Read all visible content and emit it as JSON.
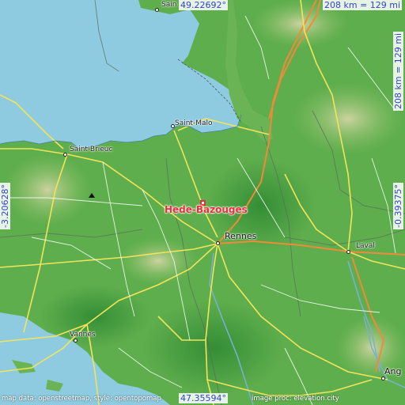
{
  "place": {
    "name": "Hede-Bazouges"
  },
  "cities": {
    "saint_malo": "Saint-Malo",
    "saint_brieuc": "Saint-Brieuc",
    "rennes": "Rennes",
    "laval": "Laval",
    "vannes": "Vannes",
    "saint_top": "Sain",
    "angers": "Ang"
  },
  "coords": {
    "north": "49.22692°",
    "south": "47.35594°",
    "west": "-3.20628°",
    "east": "-0.39375°"
  },
  "scale": {
    "top": "208 km = 129 mi",
    "side": "208 km = 129 mi"
  },
  "attribution": {
    "left": "map data: openstreetmap, style: opentopomap",
    "right": "image proc: elevation.city"
  },
  "colors": {
    "sea": "#8ecbe0",
    "land": "#5aa84a",
    "highlight": "#e8303a",
    "coord_text": "#3344cc"
  }
}
